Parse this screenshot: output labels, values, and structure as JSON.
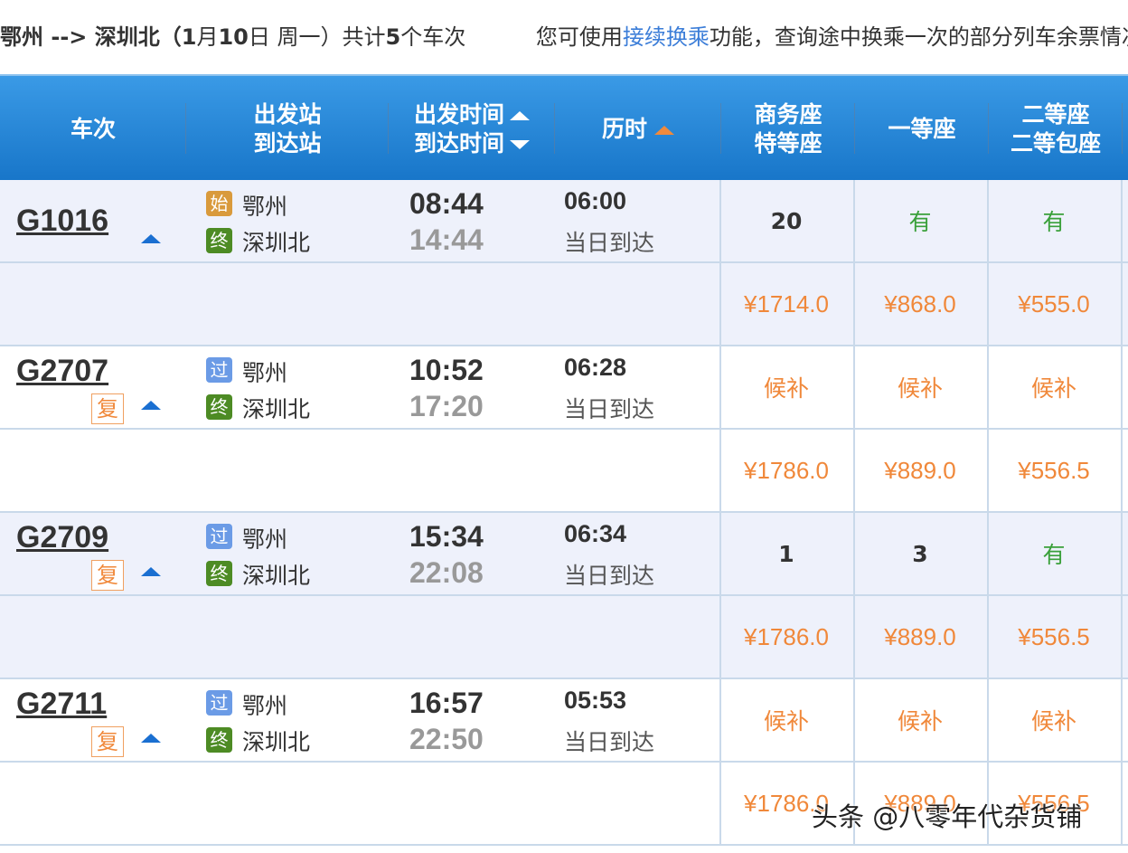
{
  "summary": {
    "route": "鄂州 --> 深圳北（",
    "month": "1",
    "month_unit": "月",
    "day": "10",
    "day_unit": "日  周一）共计",
    "count": "5",
    "count_unit": "个车次",
    "tip_prefix": "您可使用",
    "tip_link": "接续换乘",
    "tip_suffix": "功能，查询途中换乘一次的部分列车余票情况。"
  },
  "columns": {
    "train": "车次",
    "station_dep": "出发站",
    "station_arr": "到达站",
    "time_dep": "出发时间",
    "time_arr": "到达时间",
    "duration": "历时",
    "biz1": "商务座",
    "biz2": "特等座",
    "first": "一等座",
    "second1": "二等座",
    "second2": "二等包座"
  },
  "trains": [
    {
      "no": "G1016",
      "fu": "",
      "dep_badge": "始",
      "dep_badge_type": "start",
      "dep_station": "鄂州",
      "arr_badge": "终",
      "arr_station": "深圳北",
      "dep_time": "08:44",
      "arr_time": "14:44",
      "duration": "06:00",
      "arrive": "当日到达",
      "seats": [
        "20",
        "有",
        "有"
      ],
      "prices": [
        "¥1714.0",
        "¥868.0",
        "¥555.0"
      ]
    },
    {
      "no": "G2707",
      "fu": "复",
      "dep_badge": "过",
      "dep_badge_type": "pass",
      "dep_station": "鄂州",
      "arr_badge": "终",
      "arr_station": "深圳北",
      "dep_time": "10:52",
      "arr_time": "17:20",
      "duration": "06:28",
      "arrive": "当日到达",
      "seats": [
        "候补",
        "候补",
        "候补"
      ],
      "prices": [
        "¥1786.0",
        "¥889.0",
        "¥556.5"
      ]
    },
    {
      "no": "G2709",
      "fu": "复",
      "dep_badge": "过",
      "dep_badge_type": "pass",
      "dep_station": "鄂州",
      "arr_badge": "终",
      "arr_station": "深圳北",
      "dep_time": "15:34",
      "arr_time": "22:08",
      "duration": "06:34",
      "arrive": "当日到达",
      "seats": [
        "1",
        "3",
        "有"
      ],
      "prices": [
        "¥1786.0",
        "¥889.0",
        "¥556.5"
      ]
    },
    {
      "no": "G2711",
      "fu": "复",
      "dep_badge": "过",
      "dep_badge_type": "pass",
      "dep_station": "鄂州",
      "arr_badge": "终",
      "arr_station": "深圳北",
      "dep_time": "16:57",
      "arr_time": "22:50",
      "duration": "05:53",
      "arrive": "当日到达",
      "seats": [
        "候补",
        "候补",
        "候补"
      ],
      "prices": [
        "¥1786.0",
        "¥889.0",
        "¥556.5"
      ]
    }
  ],
  "watermark": "头条 @八零年代杂货铺"
}
